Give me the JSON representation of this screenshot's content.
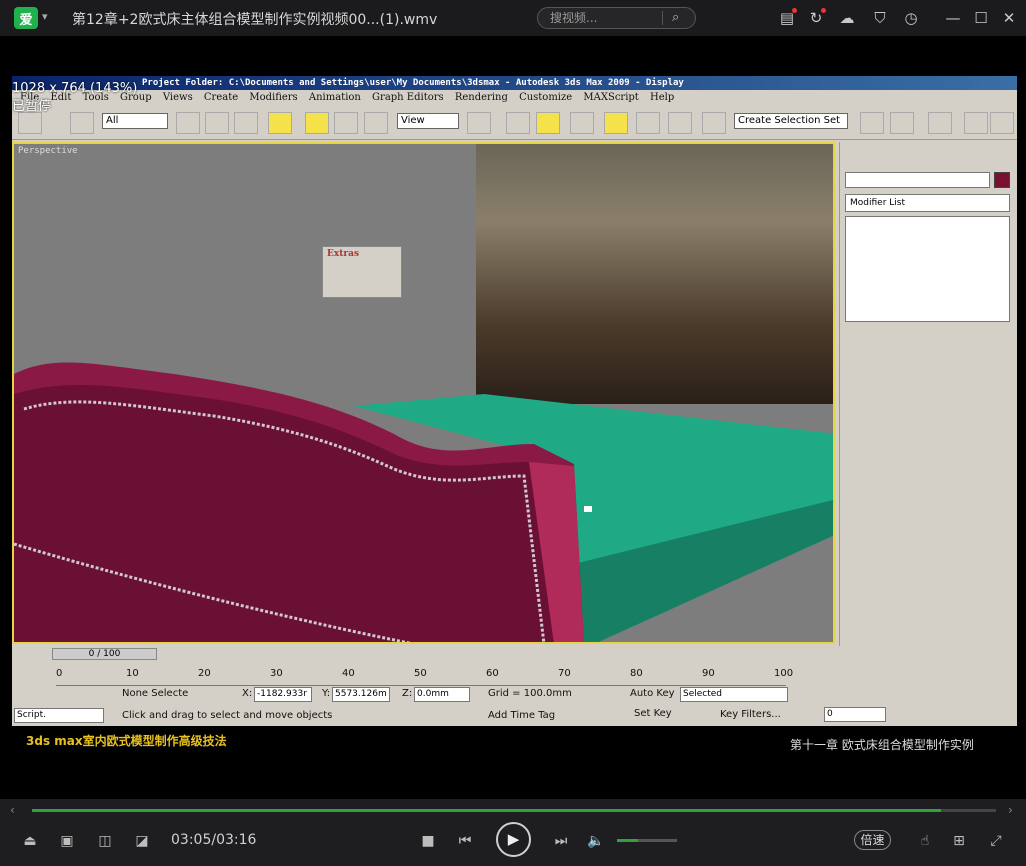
{
  "player": {
    "logo_text": "爱",
    "title": "第12章+2欧式床主体组合模型制作实例视频00...(1).wmv",
    "search_placeholder": "搜视频...",
    "title_icons": [
      "clipboard-icon",
      "refresh-icon",
      "cloud-icon",
      "shirt-icon",
      "clock-icon",
      "minimize-icon",
      "maximize-icon",
      "close-icon"
    ]
  },
  "overlay": {
    "resolution": "1028 x 764 (143%)",
    "paused": "已暂停"
  },
  "max": {
    "title": "Project Folder: C:\\Documents and Settings\\user\\My Documents\\3dsmax   - Autodesk 3ds Max 2009   - Display",
    "menu": [
      "File",
      "Edit",
      "Tools",
      "Group",
      "Views",
      "Create",
      "Modifiers",
      "Animation",
      "Graph Editors",
      "Rendering",
      "Customize",
      "MAXScript",
      "Help"
    ],
    "toolbar": {
      "filter": "All",
      "ref_coord": "View",
      "named_sel": "Create Selection Set"
    },
    "viewport_label": "Perspective",
    "extras_title": "Extras",
    "command_panel": {
      "modifier_list": "Modifier List",
      "color_swatch": "#7a1030"
    },
    "timeline": {
      "slider": "0 / 100",
      "ticks": [
        "0",
        "10",
        "20",
        "30",
        "40",
        "50",
        "60",
        "70",
        "80",
        "90",
        "100"
      ]
    },
    "status": {
      "selection": "None Selecte",
      "x_label": "X:",
      "x_value": "-1182.933r",
      "y_label": "Y:",
      "y_value": "5573.126m",
      "z_label": "Z:",
      "z_value": "0.0mm",
      "grid": "Grid = 100.0mm",
      "prompt": "Click and drag to select and move objects",
      "add_time_tag": "Add Time Tag",
      "auto_key": "Auto Key",
      "set_key": "Set Key",
      "selected": "Selected",
      "key_filters": "Key Filters...",
      "frame": "0",
      "script": "Script."
    }
  },
  "subtitles": {
    "left": "3ds max室内欧式模型制作高级技法",
    "right": "第十一章 欧式床组合模型制作实例"
  },
  "controls": {
    "time": "03:05/03:16",
    "progress": 0.943,
    "volume": 0.35,
    "speed": "倍速"
  }
}
